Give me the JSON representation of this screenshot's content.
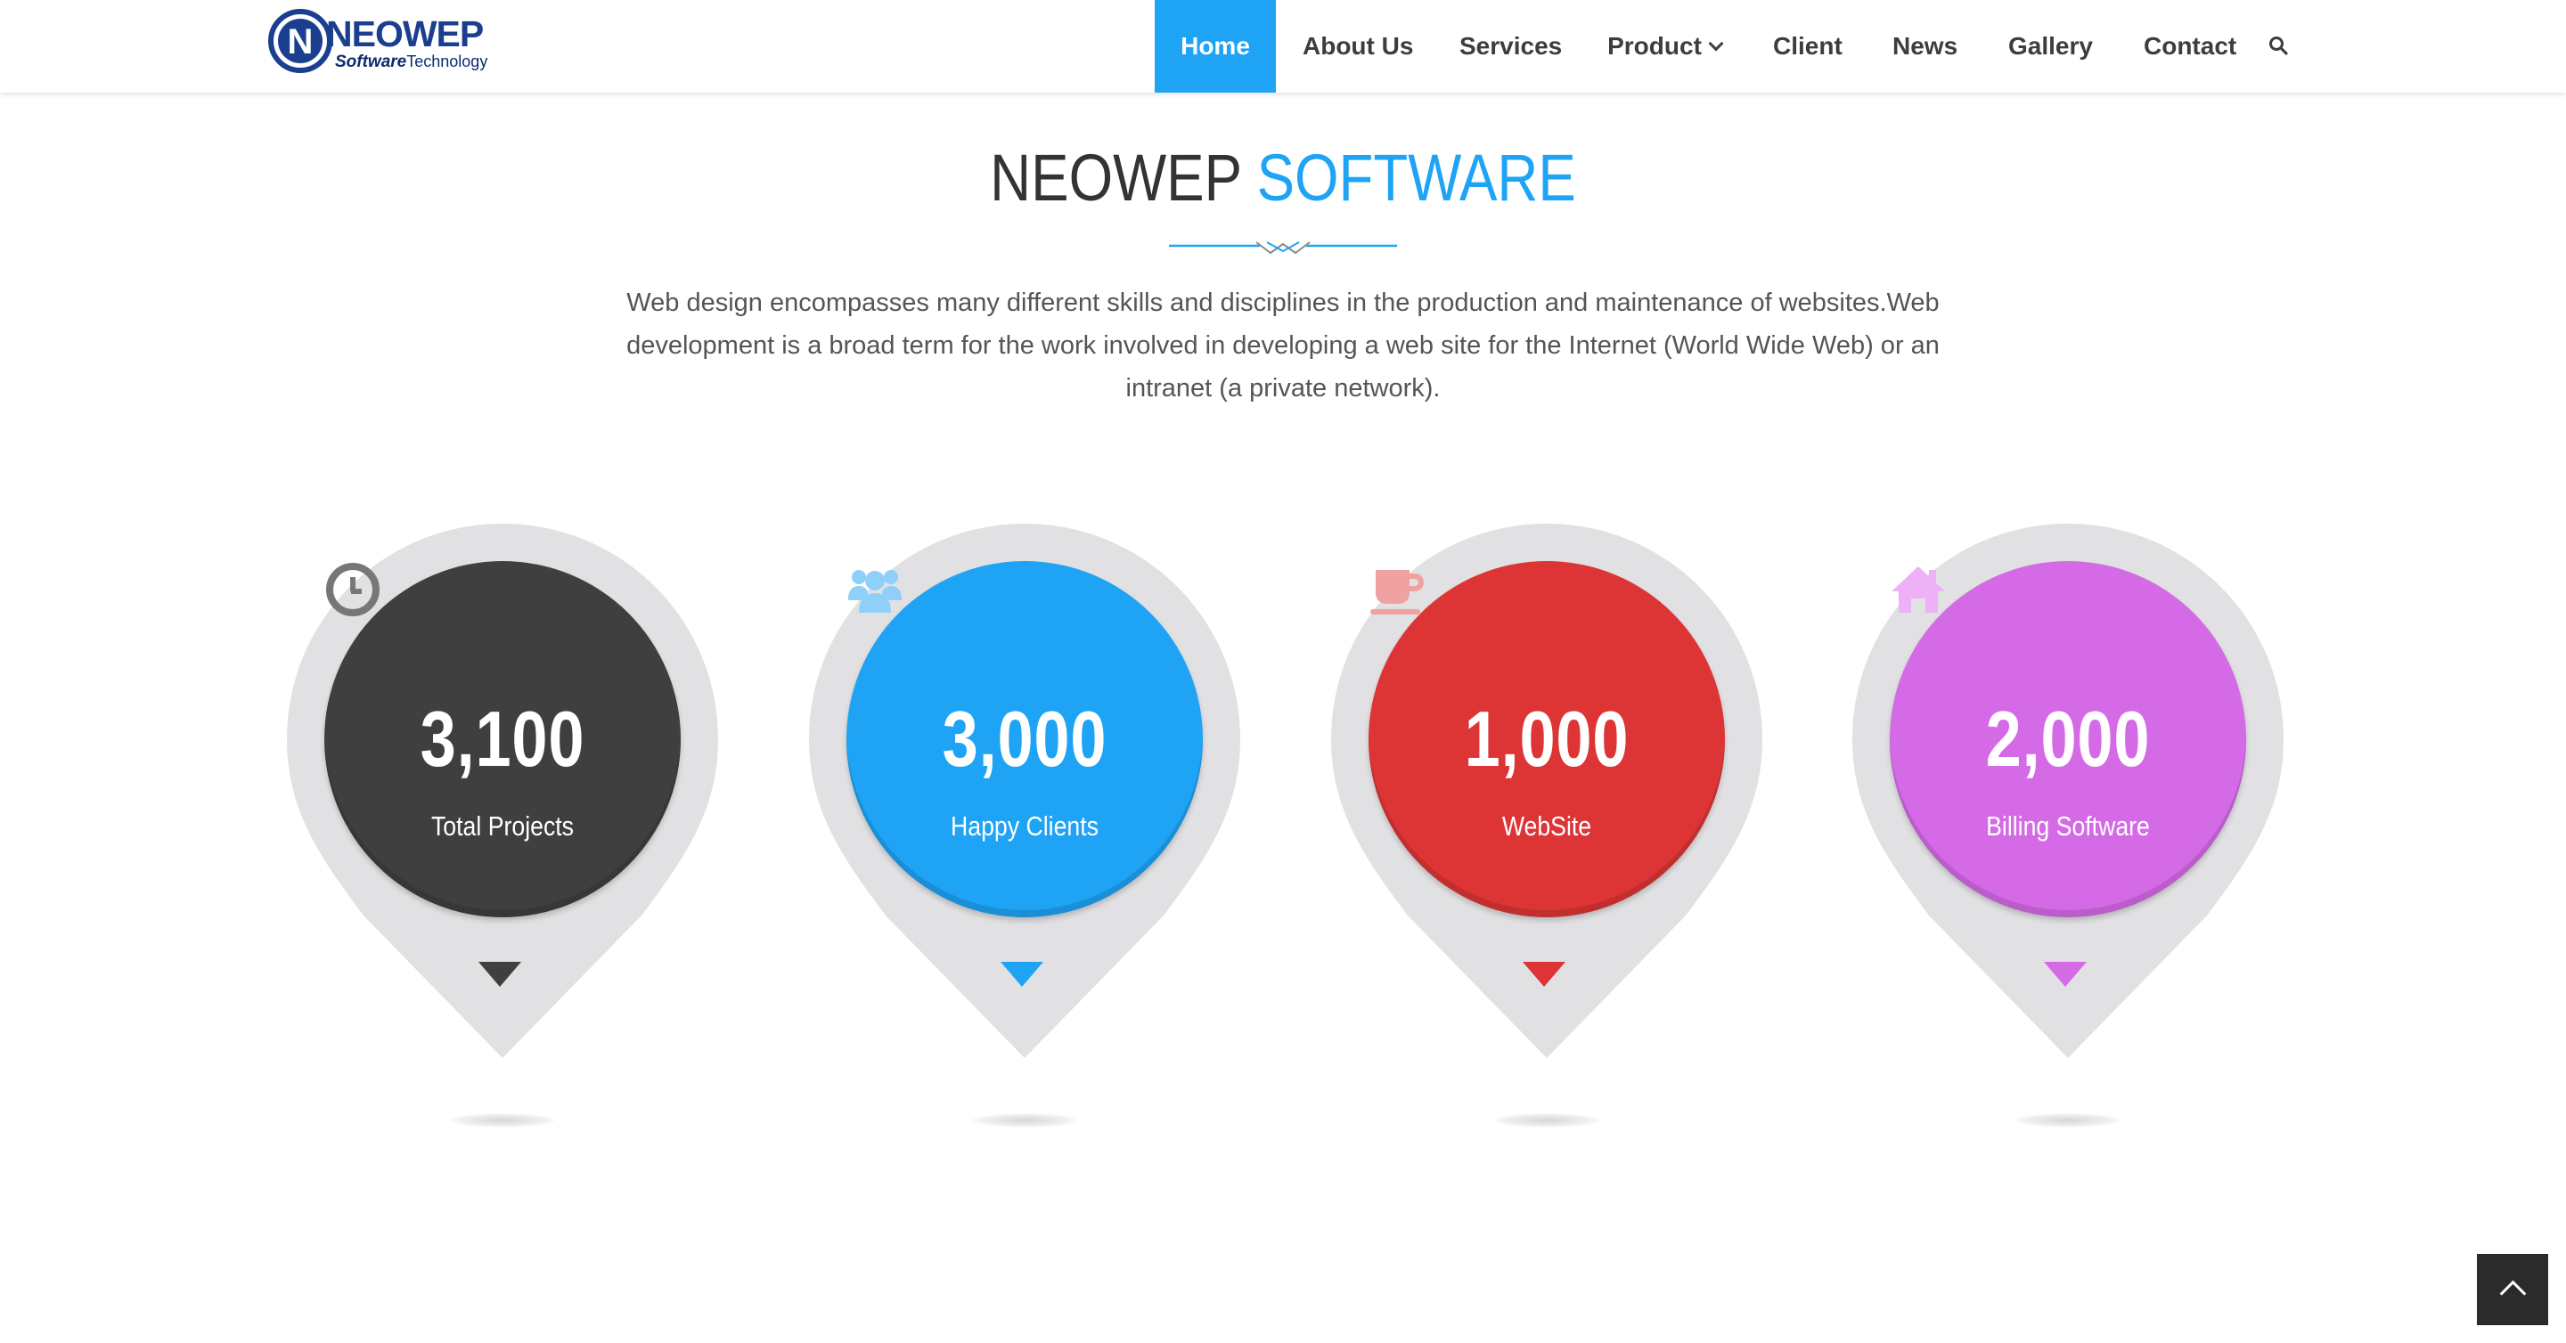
{
  "header": {
    "logo": {
      "word": "NEOWEP",
      "sub1": "Software",
      "sub2": "Technology"
    },
    "nav": [
      {
        "label": "Home",
        "active": true
      },
      {
        "label": "About Us"
      },
      {
        "label": "Services"
      },
      {
        "label": "Product",
        "dropdown": true
      },
      {
        "label": "Client"
      },
      {
        "label": "News"
      },
      {
        "label": "Gallery"
      },
      {
        "label": "Contact"
      }
    ],
    "search_icon": "search-icon"
  },
  "section": {
    "title_main": "NEOWEP",
    "title_accent": "SOFTWARE",
    "description": "Web design encompasses many different skills and disciplines in the production and maintenance of websites.Web development is a broad term for the work involved in developing a web site for the Internet (World Wide Web) or an intranet (a private network).",
    "accent_color": "#1ea3f5"
  },
  "stats": [
    {
      "value": "3,100",
      "label": "Total Projects",
      "icon": "clock-icon",
      "color": "#3f3f3f"
    },
    {
      "value": "3,000",
      "label": "Happy Clients",
      "icon": "users-icon",
      "color": "#1ea3f5"
    },
    {
      "value": "1,000",
      "label": "WebSite",
      "icon": "coffee-cup-icon",
      "color": "#dd3535"
    },
    {
      "value": "2,000",
      "label": "Billing Software",
      "icon": "home-icon",
      "color": "#d46ae6"
    }
  ],
  "back_to_top_icon": "chevron-up-icon"
}
